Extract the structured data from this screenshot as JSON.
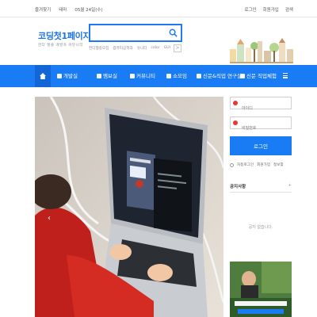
{
  "topbar": {
    "bookmark": "즐겨찾기",
    "theme": "테마",
    "date": "05월 24일(수)",
    "login": "로그인",
    "signup": "회원가입",
    "search": "검색"
  },
  "header": {
    "logo": "코딩첫1페이지",
    "tagline": "한다 할줄 개발자 커뮤니티",
    "search_placeholder": "",
    "keywords": [
      "컨디형중모집",
      "컴퓨터공학과",
      "유니티",
      "color",
      "GUI",
      "중앙"
    ],
    "keywords_nav": ">"
  },
  "nav": {
    "items": [
      "개발실",
      "멤보실",
      "커뮤니티",
      "쇼모임",
      "신문&직업 연구실",
      "신문 직업체험"
    ]
  },
  "panel": {
    "id_placeholder": "아이디",
    "pw_placeholder": "비밀번호",
    "login_button": "로그인",
    "auto_login": "자동로그인",
    "signup": "회원가입",
    "find": "정보찾"
  },
  "notice": {
    "title": "공지사항",
    "more": "+",
    "empty": "공지 없습니다."
  },
  "colors": {
    "accent": "#1a7cf5",
    "nav_dark": "#1266d6"
  }
}
